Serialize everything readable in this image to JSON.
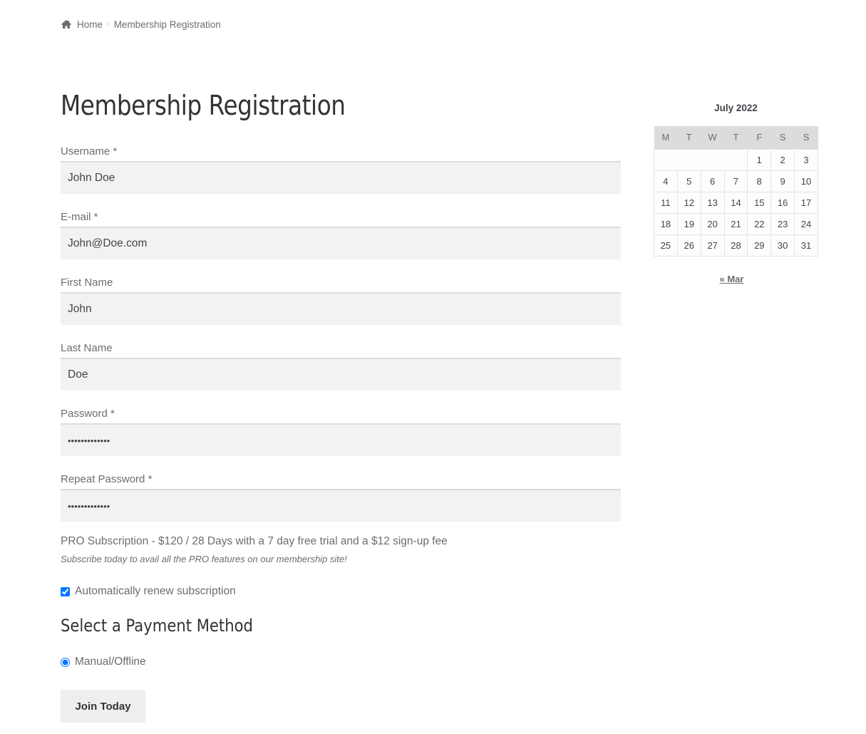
{
  "breadcrumb": {
    "icon": "home-icon",
    "home_label": "Home",
    "separator": "›",
    "current_label": "Membership Registration"
  },
  "page_title": "Membership Registration",
  "form": {
    "fields": [
      {
        "label": "Username *",
        "value": "John Doe",
        "type": "text"
      },
      {
        "label": "E-mail *",
        "value": "John@Doe.com",
        "type": "text"
      },
      {
        "label": "First Name",
        "value": "John",
        "type": "text"
      },
      {
        "label": "Last Name",
        "value": "Doe",
        "type": "text"
      },
      {
        "label": "Password *",
        "value": "•••••••••••••",
        "type": "password"
      },
      {
        "label": "Repeat Password *",
        "value": "•••••••••••••",
        "type": "password"
      }
    ],
    "subscription_description": "PRO Subscription - $120 / 28 Days with a 7 day free trial and a $12 sign-up fee",
    "subscription_note": "Subscribe today to avail all the PRO features on our membership site!",
    "auto_renew": {
      "label": "Automatically renew subscription",
      "checked": true
    },
    "payment_title": "Select a Payment Method",
    "payment_option": {
      "label": "Manual/Offline",
      "selected": true
    },
    "submit_label": "Join Today"
  },
  "calendar": {
    "caption": "July 2022",
    "weekdays": [
      "M",
      "T",
      "W",
      "T",
      "F",
      "S",
      "S"
    ],
    "weeks": [
      [
        "",
        "",
        "",
        "",
        "1",
        "2",
        "3"
      ],
      [
        "4",
        "5",
        "6",
        "7",
        "8",
        "9",
        "10"
      ],
      [
        "11",
        "12",
        "13",
        "14",
        "15",
        "16",
        "17"
      ],
      [
        "18",
        "19",
        "20",
        "21",
        "22",
        "23",
        "24"
      ],
      [
        "25",
        "26",
        "27",
        "28",
        "29",
        "30",
        "31"
      ]
    ],
    "prev_link": "« Mar"
  },
  "colors": {
    "input_bg": "#f2f2f2",
    "header_bg": "#dcdcdc",
    "button_bg": "#eeeeee",
    "accent": "#0075ff"
  }
}
